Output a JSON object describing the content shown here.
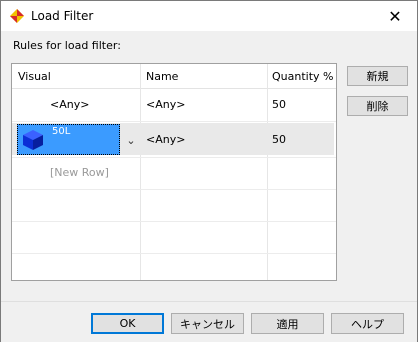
{
  "window": {
    "title": "Load Filter"
  },
  "labels": {
    "rules_label": "Rules for load filter:"
  },
  "table": {
    "columns": [
      "Visual",
      "Name",
      "Quantity %"
    ],
    "rows": [
      {
        "visual": "<Any>",
        "name": "<Any>",
        "quantity": "50"
      },
      {
        "visual": "50L",
        "name": "<Any>",
        "quantity": "50"
      }
    ],
    "new_row_placeholder": "[New Row]"
  },
  "side_buttons": {
    "new": "新規",
    "delete": "削除"
  },
  "footer_buttons": {
    "ok": "OK",
    "cancel": "キャンセル",
    "apply": "適用",
    "help": "ヘルプ"
  },
  "colors": {
    "selection_blue": "#3b9bff",
    "cube_blue": "#0b2fd6",
    "row_selected_bg": "#e9e9e9",
    "default_button_border": "#0078d7"
  },
  "icons": {
    "app_icon": "load-filter-app-icon",
    "close": "close-icon",
    "dropdown": "chevron-down-icon",
    "visual_cube": "cube-icon"
  }
}
